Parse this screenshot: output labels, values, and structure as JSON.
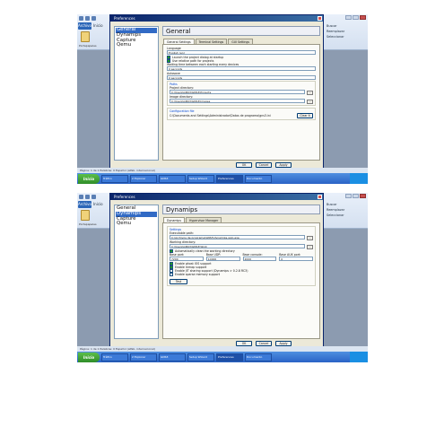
{
  "word": {
    "file_tab": "Archivo",
    "home_tab": "Inicio",
    "clipboard_label": "Portapapeles",
    "find_items": [
      "Buscar",
      "Reemplazar",
      "Seleccionar"
    ],
    "editing_label": "Edición"
  },
  "screens": [
    {
      "dialog_title": "Preferences",
      "categories": [
        "General",
        "Dynamips",
        "Capture",
        "Qemu"
      ],
      "selected_category": "General",
      "panel_title": "General",
      "tabs": [
        "General Settings",
        "Terminal Settings",
        "GUI Settings"
      ],
      "labels": {
        "language": "Language",
        "language_value": "English (en)",
        "launch_wizard": "Launch the project dialog at startup",
        "relative_paths": "Use relative path for projects",
        "delay_label": "Waiting time between each starting every devices",
        "delay_value": "0 seconds",
        "autosave_label": "Autosave",
        "autosave_value": "0 seconds",
        "paths_group": "Paths",
        "project_dir": "Project directory:",
        "project_dir_value": "C:\\Users\\GNS3\\GNS3\\Projects",
        "image_dir": "Image directory:",
        "image_dir_value": "C:\\Users\\GNS3\\GNS3\\Images",
        "config_group": "Configuration file",
        "config_value": "C:\\Documents and Settings\\Administrador\\Datos de programa\\gns3.ini",
        "clear_button": "Clear it",
        "browse": "..."
      },
      "buttons": [
        "OK",
        "Cancel",
        "Apply"
      ],
      "status": "Página: 1 de 1   Palabras: 0   Español (alfab. internacional)",
      "taskbar": [
        "Inicio",
        "Tráfico",
        "2 Explorer",
        "GNS3",
        "Setup Wizard",
        "Preferences",
        "Documento"
      ]
    },
    {
      "dialog_title": "Preferences",
      "categories": [
        "General",
        "Dynamips",
        "Capture",
        "Qemu"
      ],
      "selected_category": "Dynamips",
      "panel_title": "Dynamips",
      "tabs": [
        "Dynamips",
        "Hypervisor Manager"
      ],
      "labels": {
        "settings_group": "Settings",
        "exec_path": "Executable path:",
        "exec_value": "C:\\Archivos de programa\\GNS3\\dynamips-wxp.exe",
        "work_dir": "Working directory:",
        "work_value": "C:\\Users\\GNS3\\GNS3\\Work",
        "auto_clean": "Automatically clean the working directory",
        "base_port": "Base port:",
        "base_udp": "Base UDP:",
        "base_console": "Base console:",
        "base_aux": "Base AUX port:",
        "base_port_value": "7200",
        "base_udp_value": "10000",
        "base_console_value": "2000",
        "base_aux_value": "0",
        "ghostios": "Enable ghost IOS support",
        "mmap": "Enable mmap support",
        "jit": "Enable JIT sharing support (Dynamips > 0.2.8 RC3)",
        "sparse": "Enable sparse memory support",
        "test_button": "Test",
        "browse": "..."
      },
      "buttons": [
        "OK",
        "Cancel",
        "Apply"
      ],
      "status": "Página: 1 de 1   Palabras: 0   Español (alfab. internacional)",
      "taskbar": [
        "Inicio",
        "Tráfico",
        "2 Explorer",
        "GNS3",
        "Setup Wizard",
        "Preferences",
        "Documento"
      ]
    }
  ]
}
